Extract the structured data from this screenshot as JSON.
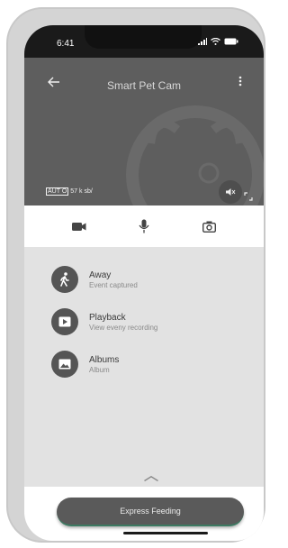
{
  "status_bar": {
    "time": "6:41"
  },
  "header": {
    "title": "Smart Pet Cam"
  },
  "stream": {
    "auto_label": "AUT O",
    "bitrate": "57 k sb/"
  },
  "menu": {
    "items": [
      {
        "title": "Away",
        "subtitle": "Event captured",
        "icon": "walking-person-icon"
      },
      {
        "title": "Playback",
        "subtitle": "View eveny recording",
        "icon": "play-icon"
      },
      {
        "title": "Albums",
        "subtitle": "Album",
        "icon": "image-icon"
      }
    ]
  },
  "feed_button": {
    "label": "Express Feeding"
  },
  "colors": {
    "dark_header": "#5e5e5e",
    "icon_circle": "#555555",
    "button": "#5a5a5a"
  }
}
